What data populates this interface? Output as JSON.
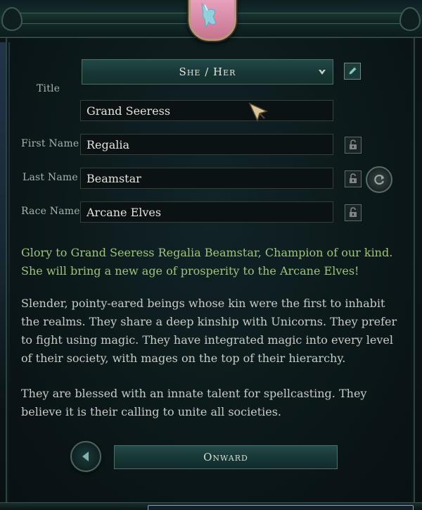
{
  "crest": {
    "icon": "unicorn-icon",
    "color": "#d9889f"
  },
  "form": {
    "title_label": "Title",
    "pronoun": "She / Her",
    "title_value": "Grand Seeress",
    "first_name_label": "First Name",
    "first_name": "Regalia",
    "last_name_label": "Last Name",
    "last_name": "Beamstar",
    "race_name_label": "Race Name",
    "race_name": "Arcane Elves"
  },
  "description": {
    "greeting": "Glory to Grand Seeress Regalia Beamstar, Champion of our kind. She will bring a new age of prosperity to the Arcane Elves!",
    "paragraph1": "Slender, pointy-eared beings whose kin were the first to inhabit the realms. They share a deep kinship with Unicorns. They prefer to fight using magic. They have integrated magic into every level of their society, with mages on the top of their hierarchy.",
    "paragraph2": "They are blessed with an innate talent for spellcasting. They believe it is their calling to unite all societies."
  },
  "buttons": {
    "onward": "Onward"
  },
  "colors": {
    "greeting_text": "#9fc47a",
    "panel_bg": "#0b1719",
    "button_teal": "#1c403d"
  }
}
